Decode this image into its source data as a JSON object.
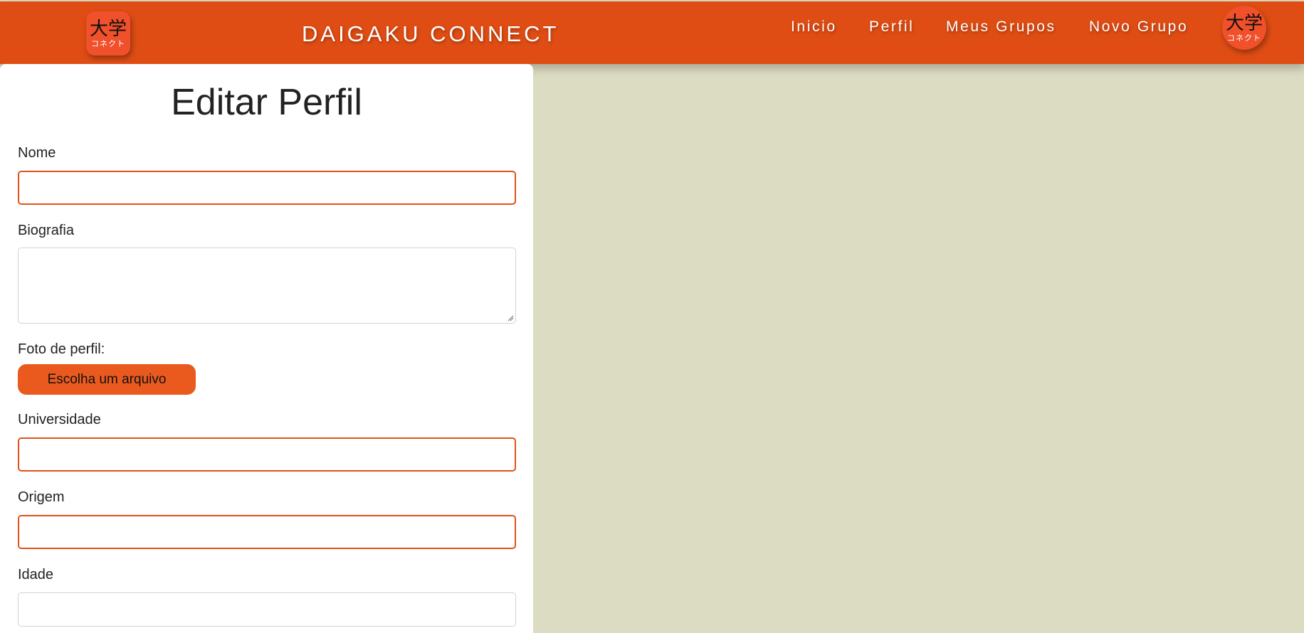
{
  "header": {
    "brand": "DAIGAKU CONNECT",
    "logo_kanji": "大学",
    "logo_kana": "コネクト",
    "nav": [
      "Inicio",
      "Perfil",
      "Meus Grupos",
      "Novo Grupo"
    ]
  },
  "form": {
    "title": "Editar Perfil",
    "fields": {
      "nome": {
        "label": "Nome",
        "value": ""
      },
      "biografia": {
        "label": "Biografia",
        "value": ""
      },
      "foto": {
        "label": "Foto de perfil:",
        "button": "Escolha um arquivo"
      },
      "universidade": {
        "label": "Universidade",
        "value": ""
      },
      "origem": {
        "label": "Origem",
        "value": ""
      },
      "idade": {
        "label": "Idade",
        "value": ""
      }
    }
  },
  "colors": {
    "header_bg": "#e04d14",
    "page_bg": "#dcdcc3",
    "accent": "#ea5a1f"
  }
}
